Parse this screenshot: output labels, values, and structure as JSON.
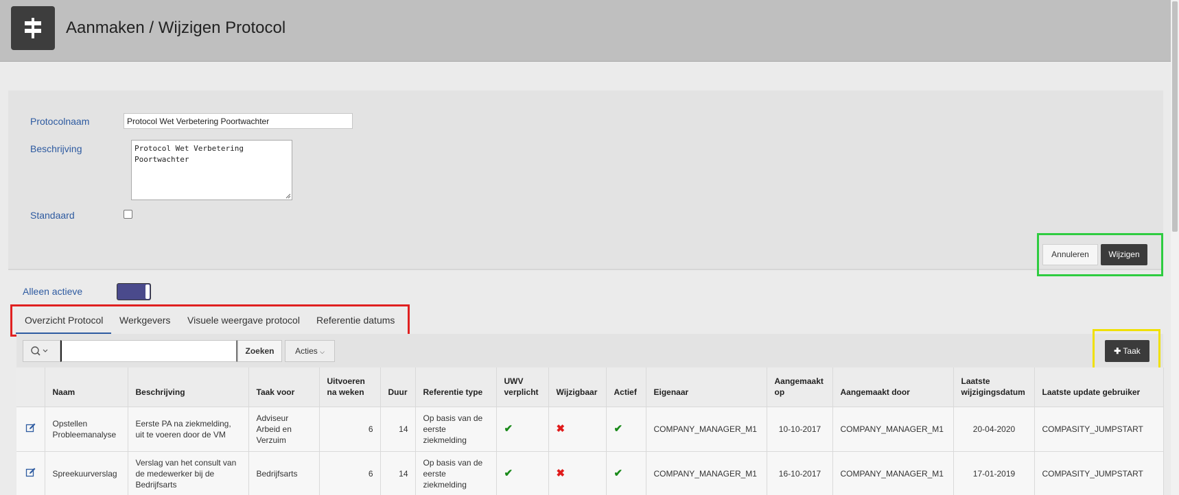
{
  "header": {
    "title": "Aanmaken / Wijzigen Protocol",
    "icon": "signpost-icon"
  },
  "form": {
    "name_label": "Protocolnaam",
    "name_value": "Protocol Wet Verbetering Poortwachter",
    "description_label": "Beschrijving",
    "description_value": "Protocol Wet Verbetering Poortwachter",
    "default_label": "Standaard",
    "default_checked": false
  },
  "actions": {
    "cancel_label": "Annuleren",
    "save_label": "Wijzigen"
  },
  "filter": {
    "active_only_label": "Alleen actieve",
    "active_only_on": true
  },
  "tabs": [
    {
      "label": "Overzicht Protocol",
      "active": true
    },
    {
      "label": "Werkgevers",
      "active": false
    },
    {
      "label": "Visuele weergave protocol",
      "active": false
    },
    {
      "label": "Referentie datums",
      "active": false
    }
  ],
  "toolbar": {
    "search_button_label": "Zoeken",
    "actions_label": "Acties",
    "add_task_label": "Taak",
    "search_value": ""
  },
  "table": {
    "columns": [
      "",
      "Naam",
      "Beschrijving",
      "Taak voor",
      "Uitvoeren na weken",
      "Duur",
      "Referentie type",
      "UWV verplicht",
      "Wijzigbaar",
      "Actief",
      "Eigenaar",
      "Aangemaakt op",
      "Aangemaakt door",
      "Laatste wijzigingsdatum",
      "Laatste update gebruiker"
    ],
    "rows": [
      {
        "naam": "Opstellen Probleemanalyse",
        "beschrijving": "Eerste PA na ziekmelding, uit te voeren door de VM",
        "taak_voor": "Adviseur Arbeid en Verzuim",
        "weken": "6",
        "duur": "14",
        "referentie": "Op basis van de eerste ziekmelding",
        "uwv": true,
        "wijzigbaar": false,
        "actief": true,
        "eigenaar": "COMPANY_MANAGER_M1",
        "aangemaakt_op": "10-10-2017",
        "aangemaakt_door": "COMPANY_MANAGER_M1",
        "laatste_wijziging": "20-04-2020",
        "laatste_gebruiker": "COMPASITY_JUMPSTART"
      },
      {
        "naam": "Spreekuurverslag",
        "beschrijving": "Verslag van het consult van de medewerker bij de Bedrijfsarts",
        "taak_voor": "Bedrijfsarts",
        "weken": "6",
        "duur": "14",
        "referentie": "Op basis van de eerste ziekmelding",
        "uwv": true,
        "wijzigbaar": false,
        "actief": true,
        "eigenaar": "COMPANY_MANAGER_M1",
        "aangemaakt_op": "16-10-2017",
        "aangemaakt_door": "COMPANY_MANAGER_M1",
        "laatste_wijziging": "17-01-2019",
        "laatste_gebruiker": "COMPASITY_JUMPSTART"
      }
    ]
  },
  "colors": {
    "header_bg": "#bfbfbf",
    "label_blue": "#2d5aa0",
    "dark_button": "#3b3b3b",
    "toggle_on": "#4a4a8c",
    "check_green": "#1a8a1a",
    "cross_red": "#e01b1b",
    "highlight_green": "#2ecc40",
    "highlight_red": "#e02020",
    "highlight_yellow": "#f0e000"
  }
}
